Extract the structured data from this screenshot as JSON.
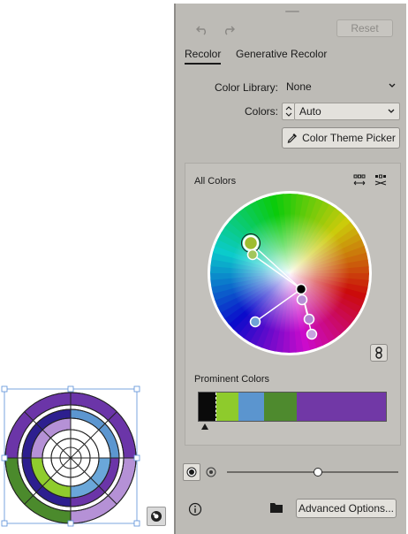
{
  "panel": {
    "reset_label": "Reset",
    "tabs": [
      {
        "label": "Recolor",
        "active": true
      },
      {
        "label": "Generative Recolor",
        "active": false
      }
    ],
    "color_library": {
      "label": "Color Library:",
      "value": "None"
    },
    "colors": {
      "label": "Colors:",
      "value": "Auto"
    },
    "theme_picker_label": "Color Theme Picker",
    "all_colors_label": "All Colors",
    "prominent_colors_label": "Prominent Colors",
    "prominent_colors": [
      {
        "color": "#0a0a0a",
        "share": 0.095
      },
      {
        "color": "#8ecb2c",
        "share": 0.115
      },
      {
        "color": "#5b95cf",
        "share": 0.14
      },
      {
        "color": "#4e8a2e",
        "share": 0.175
      },
      {
        "color": "#7138a6",
        "share": 0.475
      }
    ],
    "slider_value": 0.53,
    "advanced_options_label": "Advanced Options..."
  },
  "wheel_handles": [
    {
      "name": "base-handle-green",
      "color": "#9ebd30",
      "base": true
    },
    {
      "name": "handle-light-green",
      "color": "#a2c65c",
      "base": false
    },
    {
      "name": "handle-black",
      "color": "#000000",
      "base": false
    },
    {
      "name": "handle-lavender",
      "color": "#b68fd6",
      "base": false
    },
    {
      "name": "handle-blue",
      "color": "#6fa2d6",
      "base": false
    },
    {
      "name": "handle-violet-1",
      "color": "#b184d0",
      "base": false
    },
    {
      "name": "handle-violet-2",
      "color": "#c7a3df",
      "base": false
    }
  ],
  "artwork": {
    "colors": {
      "purple": "#6b35a8",
      "blue": "#5c96d0",
      "indigo": "#2d1f8f",
      "lavender": "#b591d6",
      "lime": "#8fcc2d",
      "green": "#4b8a2c",
      "light_blue": "#6aa7d9"
    }
  }
}
